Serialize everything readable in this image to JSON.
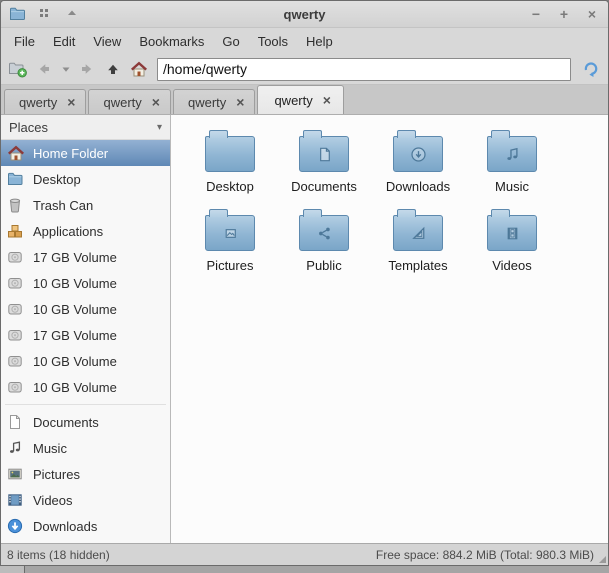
{
  "window": {
    "title": "qwerty",
    "controls": {
      "minimize": "−",
      "maximize": "+",
      "close": "×"
    }
  },
  "menubar": {
    "items": [
      "File",
      "Edit",
      "View",
      "Bookmarks",
      "Go",
      "Tools",
      "Help"
    ]
  },
  "toolbar": {
    "address": "/home/qwerty",
    "buttons": [
      {
        "name": "new-tab",
        "icon": "new-tab-icon"
      },
      {
        "name": "back",
        "icon": "back-arrow-icon"
      },
      {
        "name": "history-dropdown",
        "icon": "chevron-down-icon"
      },
      {
        "name": "forward",
        "icon": "forward-arrow-icon"
      },
      {
        "name": "up",
        "icon": "up-arrow-icon"
      },
      {
        "name": "home",
        "icon": "home-icon"
      },
      {
        "name": "reload",
        "icon": "reload-icon"
      }
    ]
  },
  "tabs": {
    "active_index": 3,
    "close_glyph": "×",
    "items": [
      {
        "label": "qwerty"
      },
      {
        "label": "qwerty"
      },
      {
        "label": "qwerty"
      },
      {
        "label": "qwerty"
      }
    ]
  },
  "sidebar": {
    "header": "Places",
    "items": [
      {
        "label": "Home Folder",
        "icon": "home",
        "selected": true
      },
      {
        "label": "Desktop",
        "icon": "folder"
      },
      {
        "label": "Trash Can",
        "icon": "trash"
      },
      {
        "label": "Applications",
        "icon": "applications"
      },
      {
        "label": "17 GB Volume",
        "icon": "drive"
      },
      {
        "label": "10 GB Volume",
        "icon": "drive"
      },
      {
        "label": "10 GB Volume",
        "icon": "drive"
      },
      {
        "label": "17 GB Volume",
        "icon": "drive"
      },
      {
        "label": "10 GB Volume",
        "icon": "drive"
      },
      {
        "label": "10 GB Volume",
        "icon": "drive"
      },
      {
        "separator": true
      },
      {
        "label": "Documents",
        "icon": "document"
      },
      {
        "label": "Music",
        "icon": "music"
      },
      {
        "label": "Pictures",
        "icon": "picture"
      },
      {
        "label": "Videos",
        "icon": "video"
      },
      {
        "label": "Downloads",
        "icon": "download"
      }
    ]
  },
  "files": [
    {
      "name": "Desktop",
      "emblem": "none"
    },
    {
      "name": "Documents",
      "emblem": "document"
    },
    {
      "name": "Downloads",
      "emblem": "download"
    },
    {
      "name": "Music",
      "emblem": "music"
    },
    {
      "name": "Pictures",
      "emblem": "picture"
    },
    {
      "name": "Public",
      "emblem": "share"
    },
    {
      "name": "Templates",
      "emblem": "template"
    },
    {
      "name": "Videos",
      "emblem": "video"
    }
  ],
  "statusbar": {
    "left": "8 items (18 hidden)",
    "right": "Free space: 884.2 MiB (Total: 980.3 MiB)"
  },
  "colors": {
    "selection_top": "#93b1d3",
    "selection_bottom": "#5f88b5",
    "folder_top": "#b2cee3",
    "folder_bottom": "#7aa6c8",
    "download_badge": "#4a90d9"
  }
}
